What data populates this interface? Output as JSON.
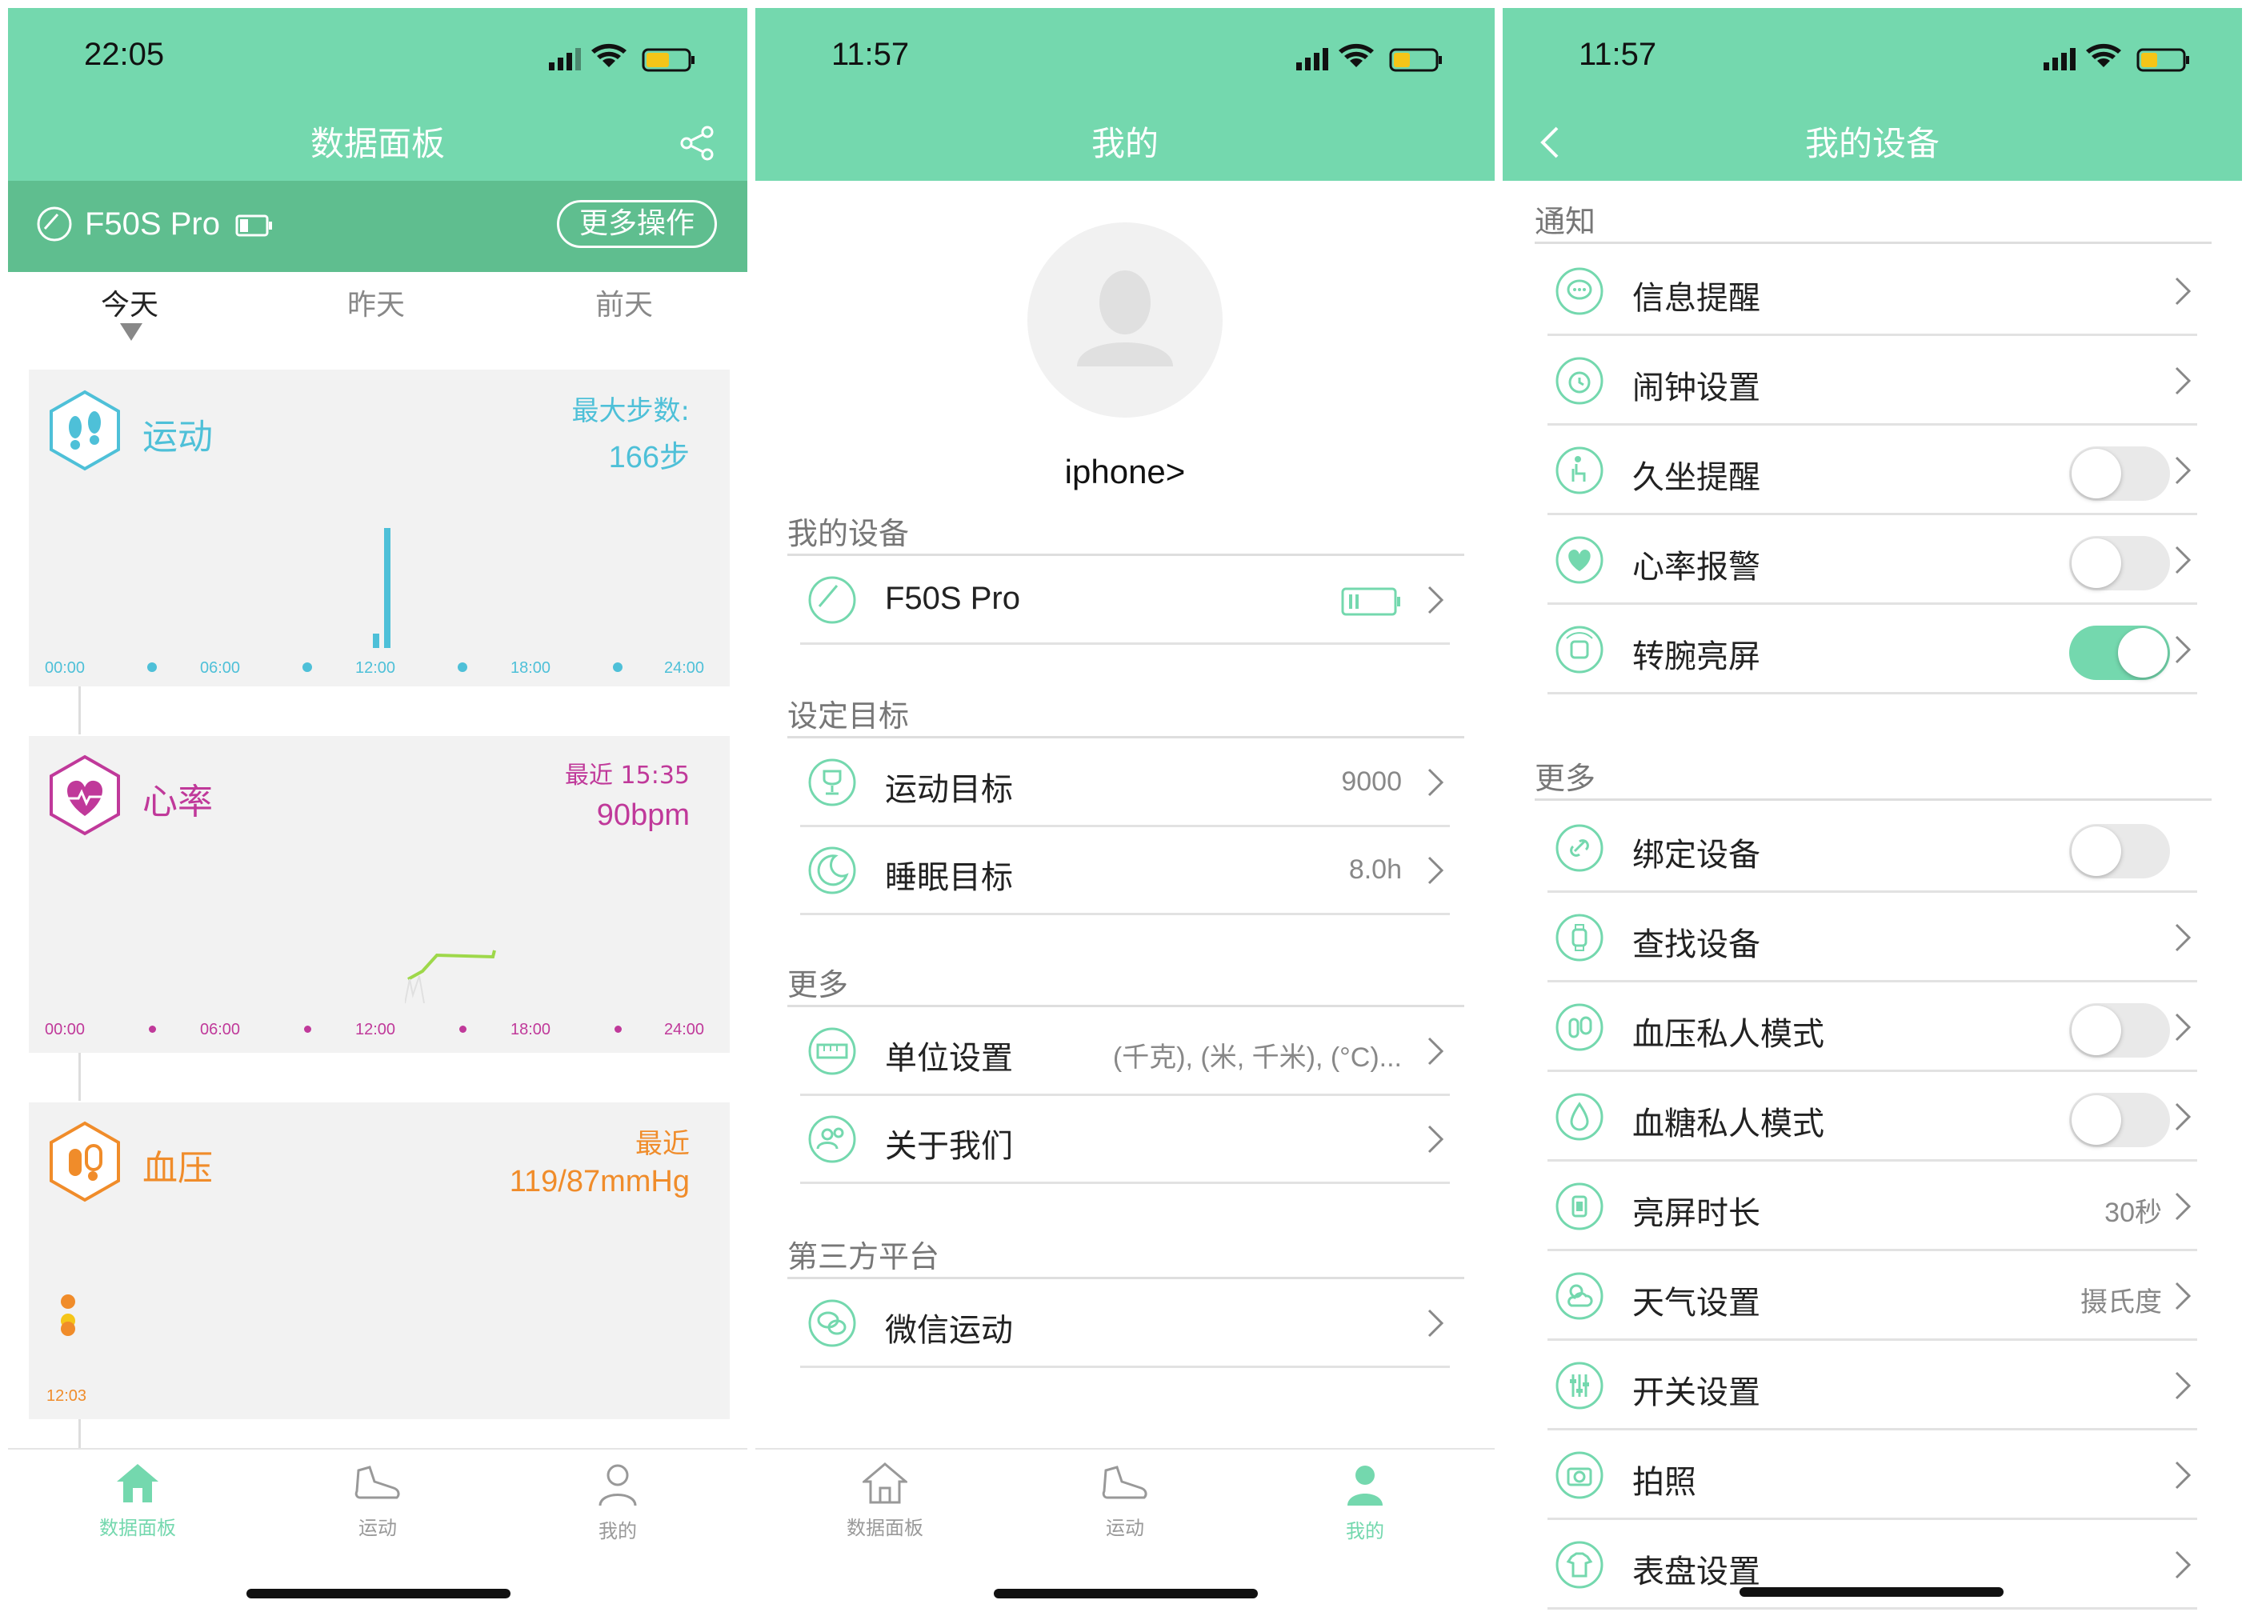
{
  "colors": {
    "accent": "#74d8ae",
    "dark_accent": "#5fbe8f",
    "sport": "#4ec0d8",
    "heart": "#c0399a",
    "bp": "#f08c2a"
  },
  "s1": {
    "time": "22:05",
    "title": "数据面板",
    "device_name": "F50S Pro",
    "more_btn": "更多操作",
    "days": [
      "今天",
      "昨天",
      "前天"
    ],
    "sport": {
      "title": "运动",
      "label": "最大步数:",
      "value": "166步",
      "ticks": [
        "00:00",
        "06:00",
        "12:00",
        "18:00",
        "24:00"
      ]
    },
    "heart": {
      "title": "心率",
      "label": "最近 15:35",
      "value": "90bpm",
      "ticks": [
        "00:00",
        "06:00",
        "12:00",
        "18:00",
        "24:00"
      ]
    },
    "bp": {
      "title": "血压",
      "label": "最近",
      "value": "119/87mmHg",
      "tick": "12:03"
    },
    "tabs": [
      "数据面板",
      "运动",
      "我的"
    ]
  },
  "s2": {
    "time": "11:57",
    "title": "我的",
    "username": "iphone>",
    "sec_device": "我的设备",
    "device_row": "F50S Pro",
    "sec_goal": "设定目标",
    "goal_rows": [
      {
        "label": "运动目标",
        "value": "9000"
      },
      {
        "label": "睡眠目标",
        "value": "8.0h"
      }
    ],
    "sec_more": "更多",
    "more_rows": [
      {
        "label": "单位设置",
        "value": "(千克), (米, 千米), (°C)..."
      },
      {
        "label": "关于我们",
        "value": ""
      }
    ],
    "sec_third": "第三方平台",
    "third_rows": [
      {
        "label": "微信运动"
      }
    ],
    "tabs": [
      "数据面板",
      "运动",
      "我的"
    ]
  },
  "s3": {
    "time": "11:57",
    "title": "我的设备",
    "sec_notify": "通知",
    "notify_rows": [
      {
        "label": "信息提醒",
        "icon": "message-icon",
        "toggle": null
      },
      {
        "label": "闹钟设置",
        "icon": "alarm-icon",
        "toggle": null
      },
      {
        "label": "久坐提醒",
        "icon": "sedentary-icon",
        "toggle": "off"
      },
      {
        "label": "心率报警",
        "icon": "heart-icon",
        "toggle": "off"
      },
      {
        "label": "转腕亮屏",
        "icon": "wrist-icon",
        "toggle": "on"
      }
    ],
    "sec_more": "更多",
    "more_rows": [
      {
        "label": "绑定设备",
        "icon": "link-icon",
        "toggle": "off",
        "value": "",
        "chevron": false
      },
      {
        "label": "查找设备",
        "icon": "watch-icon",
        "toggle": null,
        "value": "",
        "chevron": true
      },
      {
        "label": "血压私人模式",
        "icon": "bp-icon",
        "toggle": "off",
        "value": "",
        "chevron": true
      },
      {
        "label": "血糖私人模式",
        "icon": "glucose-icon",
        "toggle": "off",
        "value": "",
        "chevron": true
      },
      {
        "label": "亮屏时长",
        "icon": "screen-icon",
        "toggle": null,
        "value": "30秒",
        "chevron": true
      },
      {
        "label": "天气设置",
        "icon": "weather-icon",
        "toggle": null,
        "value": "摄氏度",
        "chevron": true
      },
      {
        "label": "开关设置",
        "icon": "switch-icon",
        "toggle": null,
        "value": "",
        "chevron": true
      },
      {
        "label": "拍照",
        "icon": "camera-icon",
        "toggle": null,
        "value": "",
        "chevron": true
      },
      {
        "label": "表盘设置",
        "icon": "dial-icon",
        "toggle": null,
        "value": "",
        "chevron": true
      }
    ]
  }
}
